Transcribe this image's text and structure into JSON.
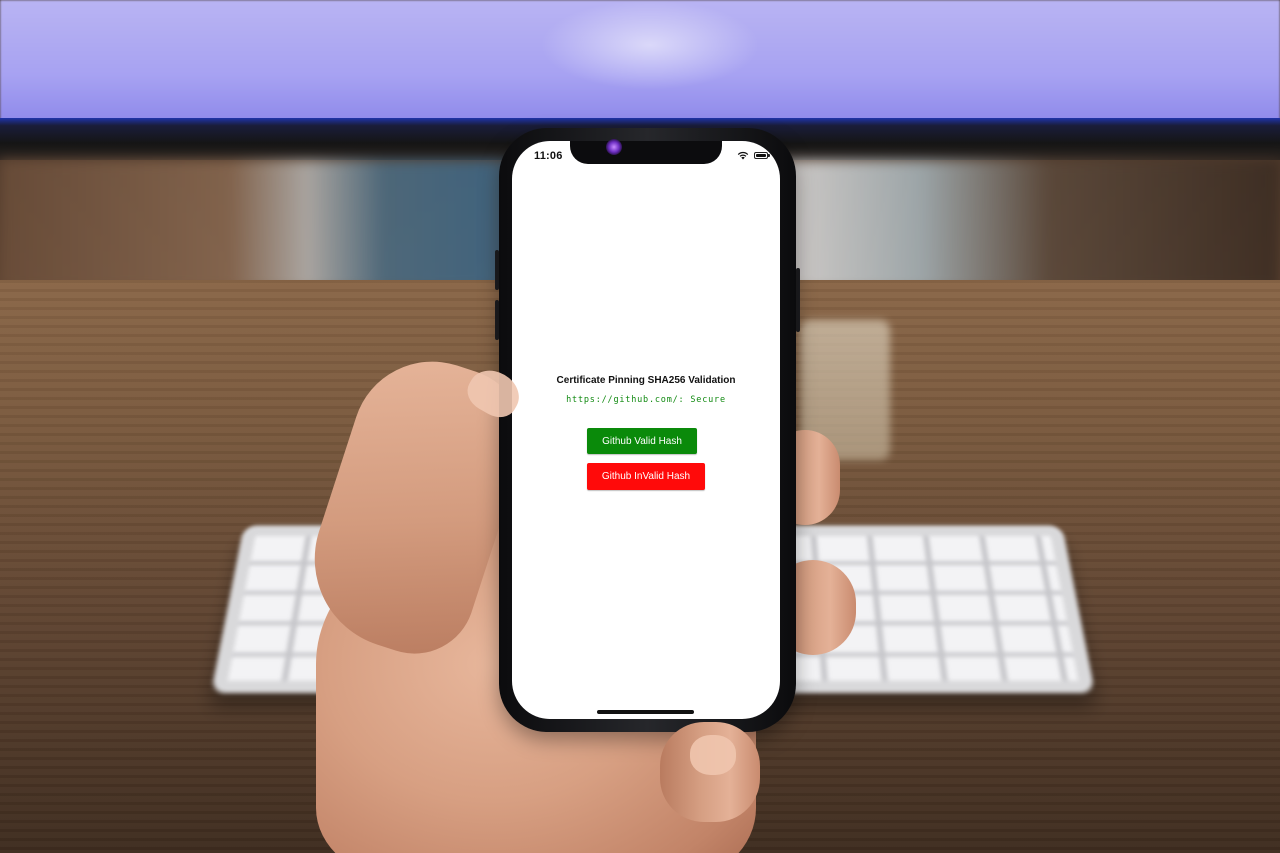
{
  "status_bar": {
    "time": "11:06",
    "icons": [
      "wifi-icon",
      "battery-icon"
    ]
  },
  "app": {
    "title": "Certificate Pinning SHA256 Validation",
    "status_text": "https://github.com/: Secure",
    "status_color": "#118a11",
    "buttons": {
      "valid_label": "Github Valid Hash",
      "valid_color": "#0a8a0a",
      "invalid_label": "Github InValid Hash",
      "invalid_color": "#ff0a0a"
    }
  }
}
